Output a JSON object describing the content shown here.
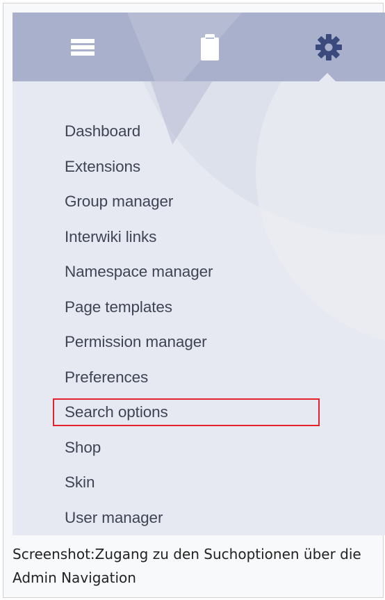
{
  "toolbar": {
    "icons": [
      "menu-icon",
      "clipboard-icon",
      "gear-icon"
    ],
    "active": "gear-icon",
    "background_color": "#a9b0cb",
    "icon_color": "#ffffff",
    "active_icon_color": "#3b4a7c"
  },
  "admin_menu": {
    "items": [
      "Dashboard",
      "Extensions",
      "Group manager",
      "Interwiki links",
      "Namespace manager",
      "Page templates",
      "Permission manager",
      "Preferences",
      "Search options",
      "Shop",
      "Skin",
      "User manager"
    ],
    "highlighted": "Search options",
    "highlight_color": "#e3222b",
    "text_color": "#3e4455"
  },
  "caption": {
    "text": "Screenshot:Zugang zu den Suchoptionen über die Admin Navigation"
  }
}
